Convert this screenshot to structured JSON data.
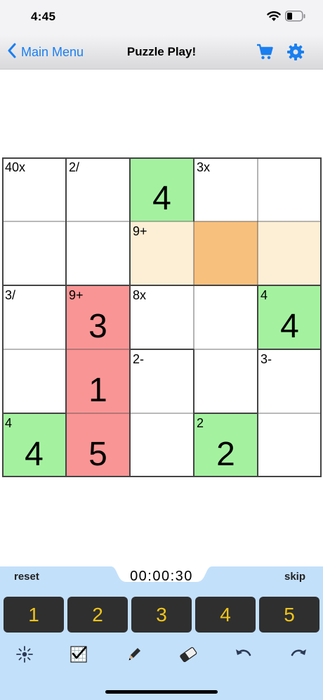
{
  "status_bar": {
    "time": "4:45"
  },
  "nav": {
    "back_label": "Main Menu",
    "title": "Puzzle Play!"
  },
  "colors": {
    "accent": "#1a7ff0",
    "given_cell": "#a4f2a0",
    "error_cell": "#fa9595",
    "cage_highlight": "#fdefd6",
    "selected_cell": "#f8c07d",
    "key_bg": "#2f2f30",
    "key_text": "#f0c419",
    "panel": "#c3e0fb"
  },
  "grid": {
    "size": 5,
    "cells": [
      {
        "row": 0,
        "col": 0,
        "label": "40x",
        "value": "",
        "state": "normal"
      },
      {
        "row": 0,
        "col": 1,
        "label": "2/",
        "value": "",
        "state": "normal"
      },
      {
        "row": 0,
        "col": 2,
        "label": "",
        "value": "4",
        "state": "given"
      },
      {
        "row": 0,
        "col": 3,
        "label": "3x",
        "value": "",
        "state": "normal"
      },
      {
        "row": 0,
        "col": 4,
        "label": "",
        "value": "",
        "state": "normal"
      },
      {
        "row": 1,
        "col": 0,
        "label": "",
        "value": "",
        "state": "normal"
      },
      {
        "row": 1,
        "col": 1,
        "label": "",
        "value": "",
        "state": "normal"
      },
      {
        "row": 1,
        "col": 2,
        "label": "9+",
        "value": "",
        "state": "cage"
      },
      {
        "row": 1,
        "col": 3,
        "label": "",
        "value": "",
        "state": "selected"
      },
      {
        "row": 1,
        "col": 4,
        "label": "",
        "value": "",
        "state": "cage"
      },
      {
        "row": 2,
        "col": 0,
        "label": "3/",
        "value": "",
        "state": "normal"
      },
      {
        "row": 2,
        "col": 1,
        "label": "9+",
        "value": "3",
        "state": "error"
      },
      {
        "row": 2,
        "col": 2,
        "label": "8x",
        "value": "",
        "state": "normal"
      },
      {
        "row": 2,
        "col": 3,
        "label": "",
        "value": "",
        "state": "normal"
      },
      {
        "row": 2,
        "col": 4,
        "label": "4",
        "value": "4",
        "state": "given"
      },
      {
        "row": 3,
        "col": 0,
        "label": "",
        "value": "",
        "state": "normal"
      },
      {
        "row": 3,
        "col": 1,
        "label": "",
        "value": "1",
        "state": "error"
      },
      {
        "row": 3,
        "col": 2,
        "label": "2-",
        "value": "",
        "state": "normal"
      },
      {
        "row": 3,
        "col": 3,
        "label": "",
        "value": "",
        "state": "normal"
      },
      {
        "row": 3,
        "col": 4,
        "label": "3-",
        "value": "",
        "state": "normal"
      },
      {
        "row": 4,
        "col": 0,
        "label": "4",
        "value": "4",
        "state": "given"
      },
      {
        "row": 4,
        "col": 1,
        "label": "",
        "value": "5",
        "state": "error"
      },
      {
        "row": 4,
        "col": 2,
        "label": "",
        "value": "",
        "state": "normal"
      },
      {
        "row": 4,
        "col": 3,
        "label": "2",
        "value": "2",
        "state": "given"
      },
      {
        "row": 4,
        "col": 4,
        "label": "",
        "value": "",
        "state": "normal"
      }
    ]
  },
  "controls": {
    "reset_label": "reset",
    "skip_label": "skip",
    "timer": "00:00:30",
    "keys": [
      "1",
      "2",
      "3",
      "4",
      "5"
    ],
    "tools": [
      {
        "name": "hint-icon"
      },
      {
        "name": "check-grid-icon"
      },
      {
        "name": "pencil-icon"
      },
      {
        "name": "eraser-icon"
      },
      {
        "name": "undo-icon"
      },
      {
        "name": "redo-icon"
      }
    ]
  }
}
